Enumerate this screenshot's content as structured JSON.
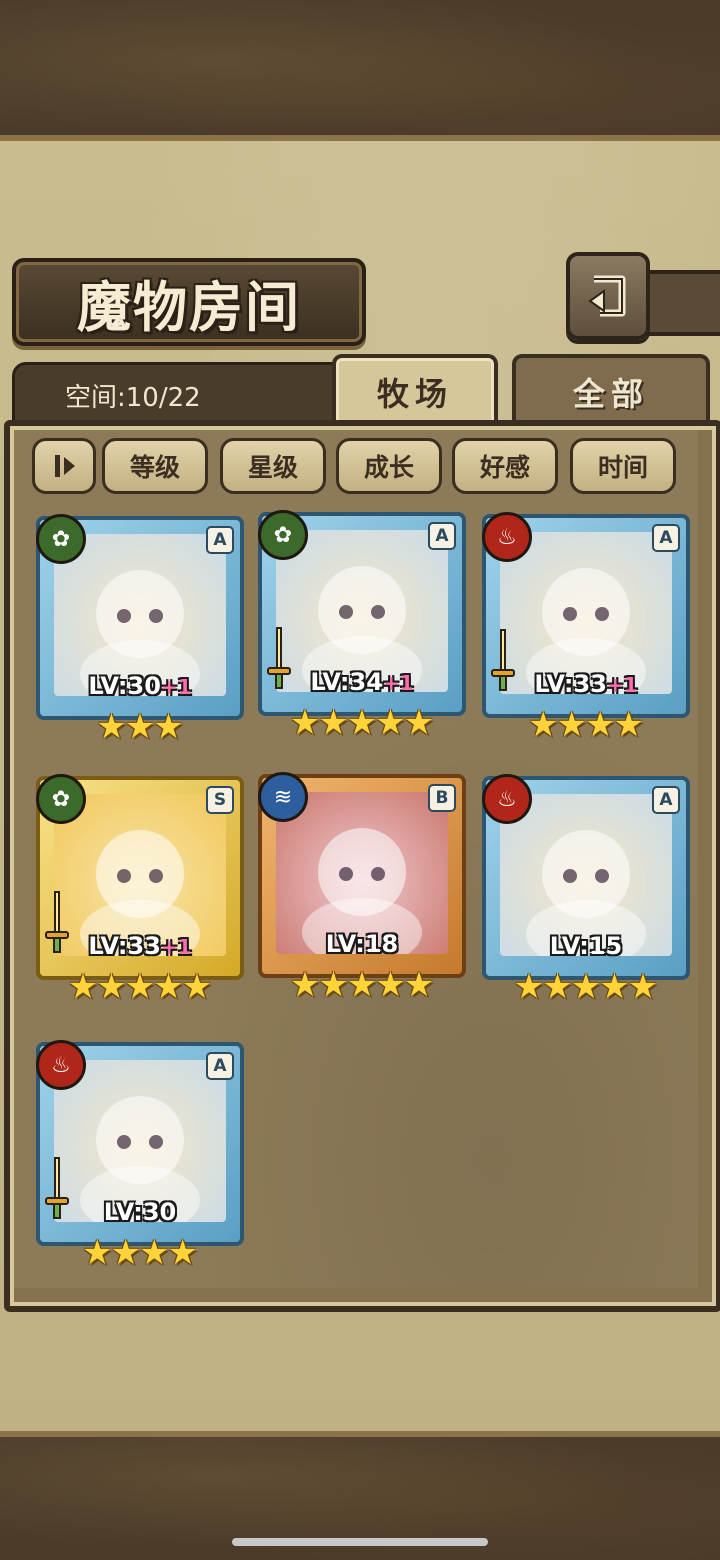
{
  "title": "魔物房间",
  "space": {
    "label": "空间:10/22"
  },
  "tabs": [
    {
      "label": "牧场",
      "active": true
    },
    {
      "label": "全部",
      "active": false
    }
  ],
  "filters": [
    "等级",
    "星级",
    "成长",
    "好感",
    "时间"
  ],
  "monsters": [
    {
      "element": "nature",
      "rank": "A",
      "level": "LV:30",
      "bonus": "+1",
      "stars": 3,
      "weapon": false,
      "frame": "rare-a"
    },
    {
      "element": "nature",
      "rank": "A",
      "level": "LV:34",
      "bonus": "+1",
      "stars": 5,
      "weapon": true,
      "frame": "rare-a"
    },
    {
      "element": "fire",
      "rank": "A",
      "level": "LV:33",
      "bonus": "+1",
      "stars": 4,
      "weapon": true,
      "frame": "rare-a"
    },
    {
      "element": "nature",
      "rank": "S",
      "level": "LV:33",
      "bonus": "+1",
      "stars": 5,
      "weapon": true,
      "frame": "rare-s"
    },
    {
      "element": "water",
      "rank": "B",
      "level": "LV:18",
      "bonus": "",
      "stars": 5,
      "weapon": false,
      "frame": "rare-b"
    },
    {
      "element": "fire",
      "rank": "A",
      "level": "LV:15",
      "bonus": "",
      "stars": 5,
      "weapon": false,
      "frame": "rare-a"
    },
    {
      "element": "fire",
      "rank": "A",
      "level": "LV:30",
      "bonus": "",
      "stars": 4,
      "weapon": true,
      "frame": "rare-a"
    }
  ]
}
